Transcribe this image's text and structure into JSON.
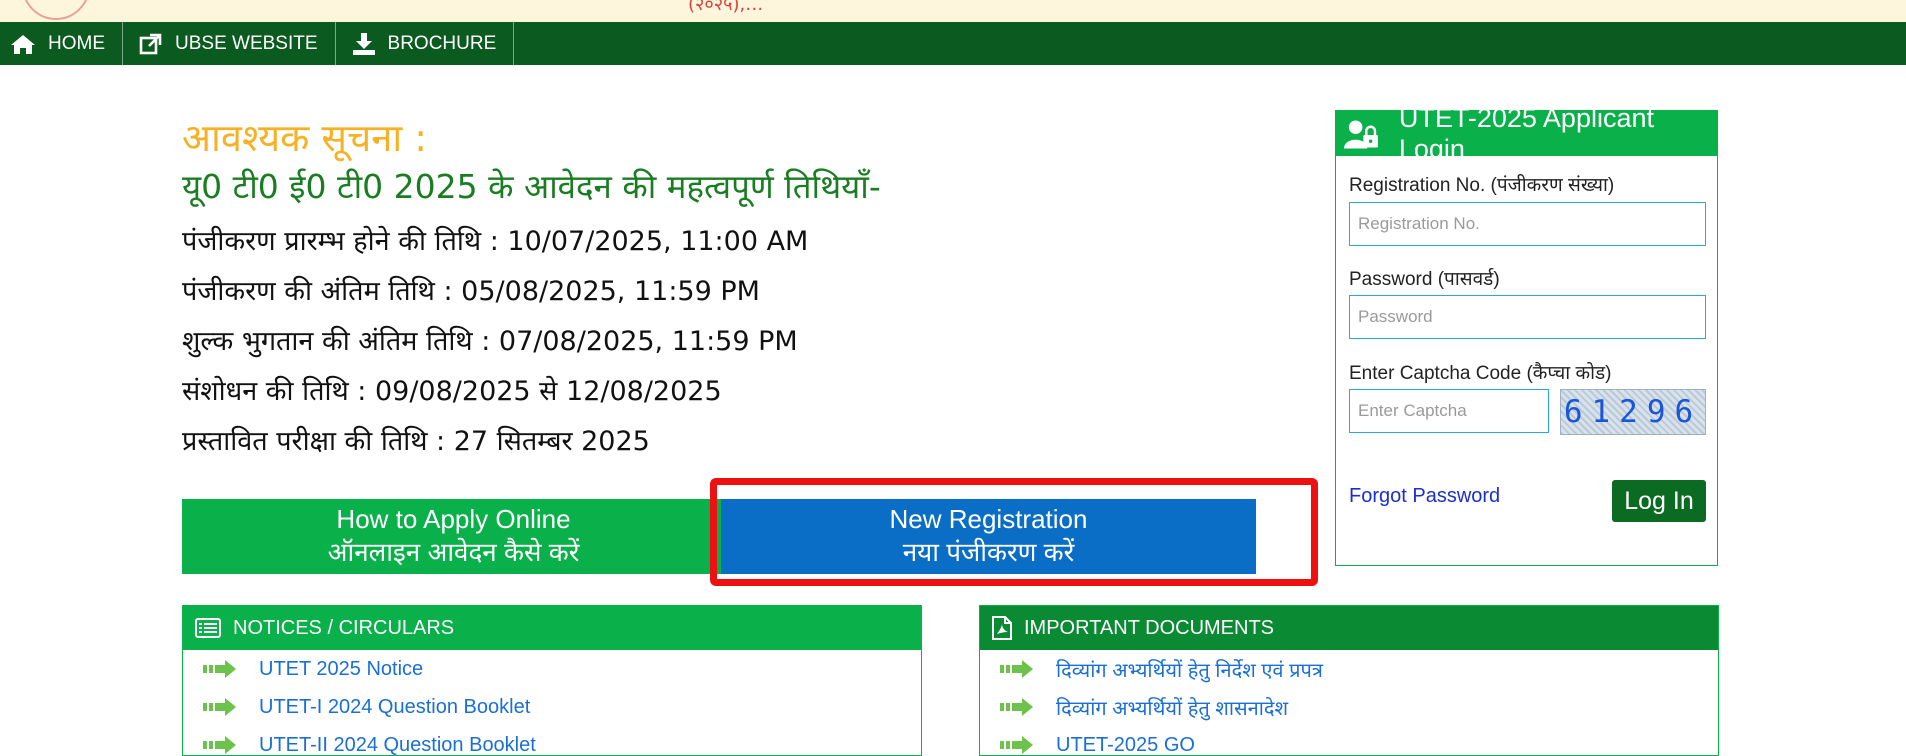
{
  "top": {
    "fragment": "(२०२५),…"
  },
  "nav": [
    {
      "label": "HOME",
      "icon": "home-icon"
    },
    {
      "label": "UBSE WEBSITE",
      "icon": "external-link-icon"
    },
    {
      "label": "BROCHURE",
      "icon": "download-icon"
    }
  ],
  "notice": {
    "title": "आवश्यक सूचना :",
    "subtitle": "यू0 टी0 ई0 टी0 2025 के आवेदन की महत्वपूर्ण तिथियाँ-",
    "dates": [
      "पंजीकरण प्रारम्भ होने की तिथि : 10/07/2025, 11:00 AM",
      "पंजीकरण की अंतिम तिथि : 05/08/2025, 11:59 PM",
      "शुल्क भुगतान की अंतिम तिथि : 07/08/2025, 11:59 PM",
      "संशोधन की तिथि : 09/08/2025 से 12/08/2025",
      "प्रस्तावित परीक्षा की तिथि : 27 सितम्बर 2025"
    ]
  },
  "buttons": {
    "howto_en": "How to Apply Online",
    "howto_hi": "ऑनलाइन आवेदन कैसे करें",
    "newreg_en": "New Registration",
    "newreg_hi": "नया पंजीकरण करें"
  },
  "login": {
    "title": "UTET-2025 Applicant Login",
    "reg_label": "Registration No. (पंजीकरण संख्या)",
    "reg_placeholder": "Registration No.",
    "pwd_label": "Password (पासवर्ड)",
    "pwd_placeholder": "Password",
    "captcha_label": "Enter Captcha Code (कैप्चा कोड)",
    "captcha_placeholder": "Enter Captcha",
    "captcha_code": "61296",
    "forgot": "Forgot Password",
    "login_btn": "Log In"
  },
  "notices": {
    "title": "NOTICES / CIRCULARS",
    "items": [
      "UTET 2025 Notice",
      "UTET-I 2024 Question Booklet",
      "UTET-II 2024 Question Booklet"
    ]
  },
  "documents": {
    "title": "IMPORTANT DOCUMENTS",
    "items": [
      "दिव्यांग अभ्यर्थियों हेतु निर्देश एवं प्रपत्र",
      "दिव्यांग अभ्यर्थियों हेतु शासनादेश",
      "UTET-2025 GO"
    ]
  },
  "colors": {
    "nav_bg": "#0b5a1f",
    "accent_green": "#0ab14b",
    "primary_blue": "#0a6ec7",
    "notice_title": "#f5b226",
    "highlight_red": "#ee1111"
  }
}
